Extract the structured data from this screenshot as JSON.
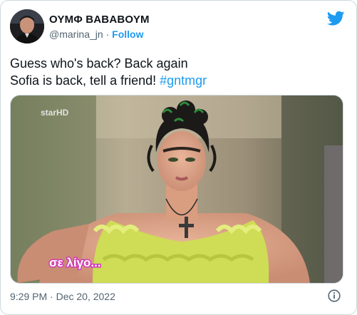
{
  "author": {
    "display_name": "ΟΥΜΦ ΒΑΒΑΒΟΥΜ",
    "handle": "@marina_jn",
    "separator": "·",
    "follow_label": "Follow"
  },
  "tweet": {
    "line1": "Guess who's back? Back again",
    "line2_prefix": "Sofia is back, tell a friend! ",
    "hashtag": "#gntmgr"
  },
  "media": {
    "watermark": "starHD",
    "caption_overlay": "σε λίγο..."
  },
  "footer": {
    "timestamp": "9:29 PM · Dec 20, 2022"
  },
  "icons": {
    "brand": "twitter-bird-icon",
    "info": "info-icon"
  },
  "colors": {
    "accent": "#1d9bf0",
    "text_primary": "#0f1419",
    "text_secondary": "#536471",
    "border": "#cfd9de"
  }
}
